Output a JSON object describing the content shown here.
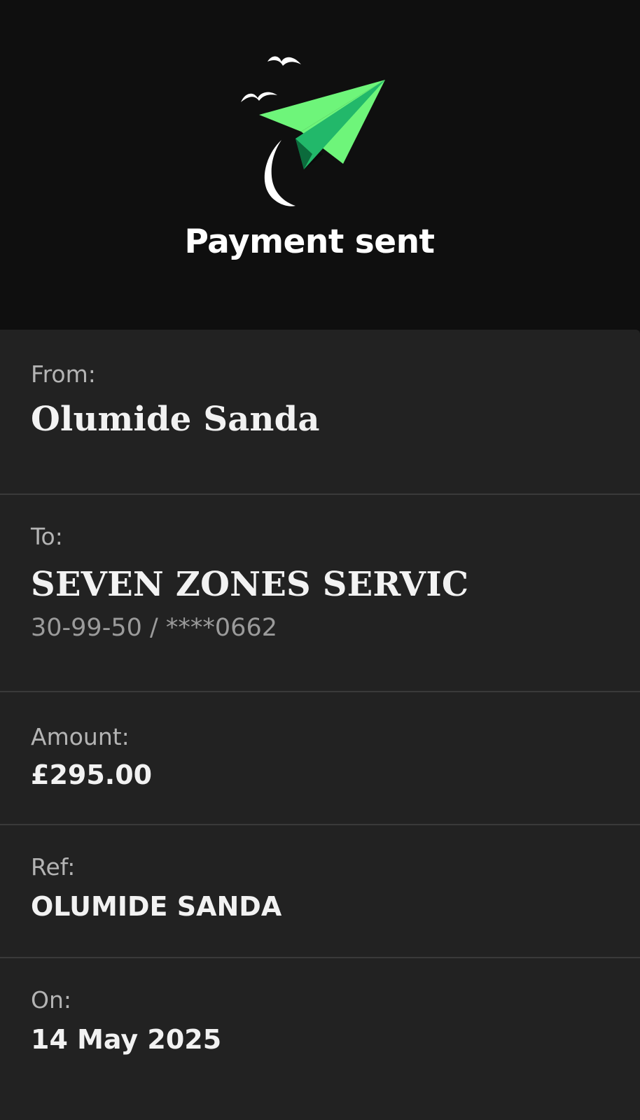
{
  "header": {
    "icon": "paper-plane-with-birds-icon",
    "title": "Payment sent"
  },
  "colors": {
    "header_bg": "#0f0f0f",
    "card_bg": "#222222",
    "accent_green": "#6ef57a",
    "accent_green_dark": "#22b86a"
  },
  "details": {
    "from": {
      "label": "From:",
      "value": "Olumide Sanda"
    },
    "to": {
      "label": "To:",
      "value": "SEVEN ZONES SERVIC",
      "account": "30-99-50 / ****0662"
    },
    "amount": {
      "label": "Amount:",
      "value": "£295.00"
    },
    "ref": {
      "label": "Ref:",
      "value": "OLUMIDE SANDA"
    },
    "on": {
      "label": "On:",
      "value": "14 May 2025"
    }
  }
}
